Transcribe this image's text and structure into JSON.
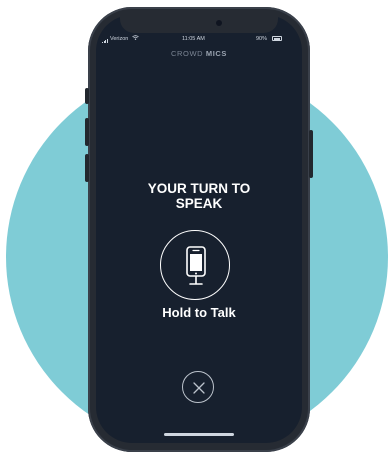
{
  "status": {
    "carrier": "Verizon",
    "time": "11:05 AM",
    "battery": "90%"
  },
  "app": {
    "title_light": "CROWD",
    "title_bold": "MICS"
  },
  "prompt": {
    "line1": "YOUR TURN TO",
    "line2": "SPEAK"
  },
  "hold": {
    "label": "Hold to Talk"
  },
  "icons": {
    "mic": "phone-mic-icon",
    "close": "close-icon",
    "signal": "signal-icon",
    "wifi": "wifi-icon",
    "battery": "battery-icon"
  },
  "colors": {
    "background_circle": "#7fccd6",
    "screen": "#17202e",
    "frame": "#262b33",
    "text": "#ffffff"
  }
}
